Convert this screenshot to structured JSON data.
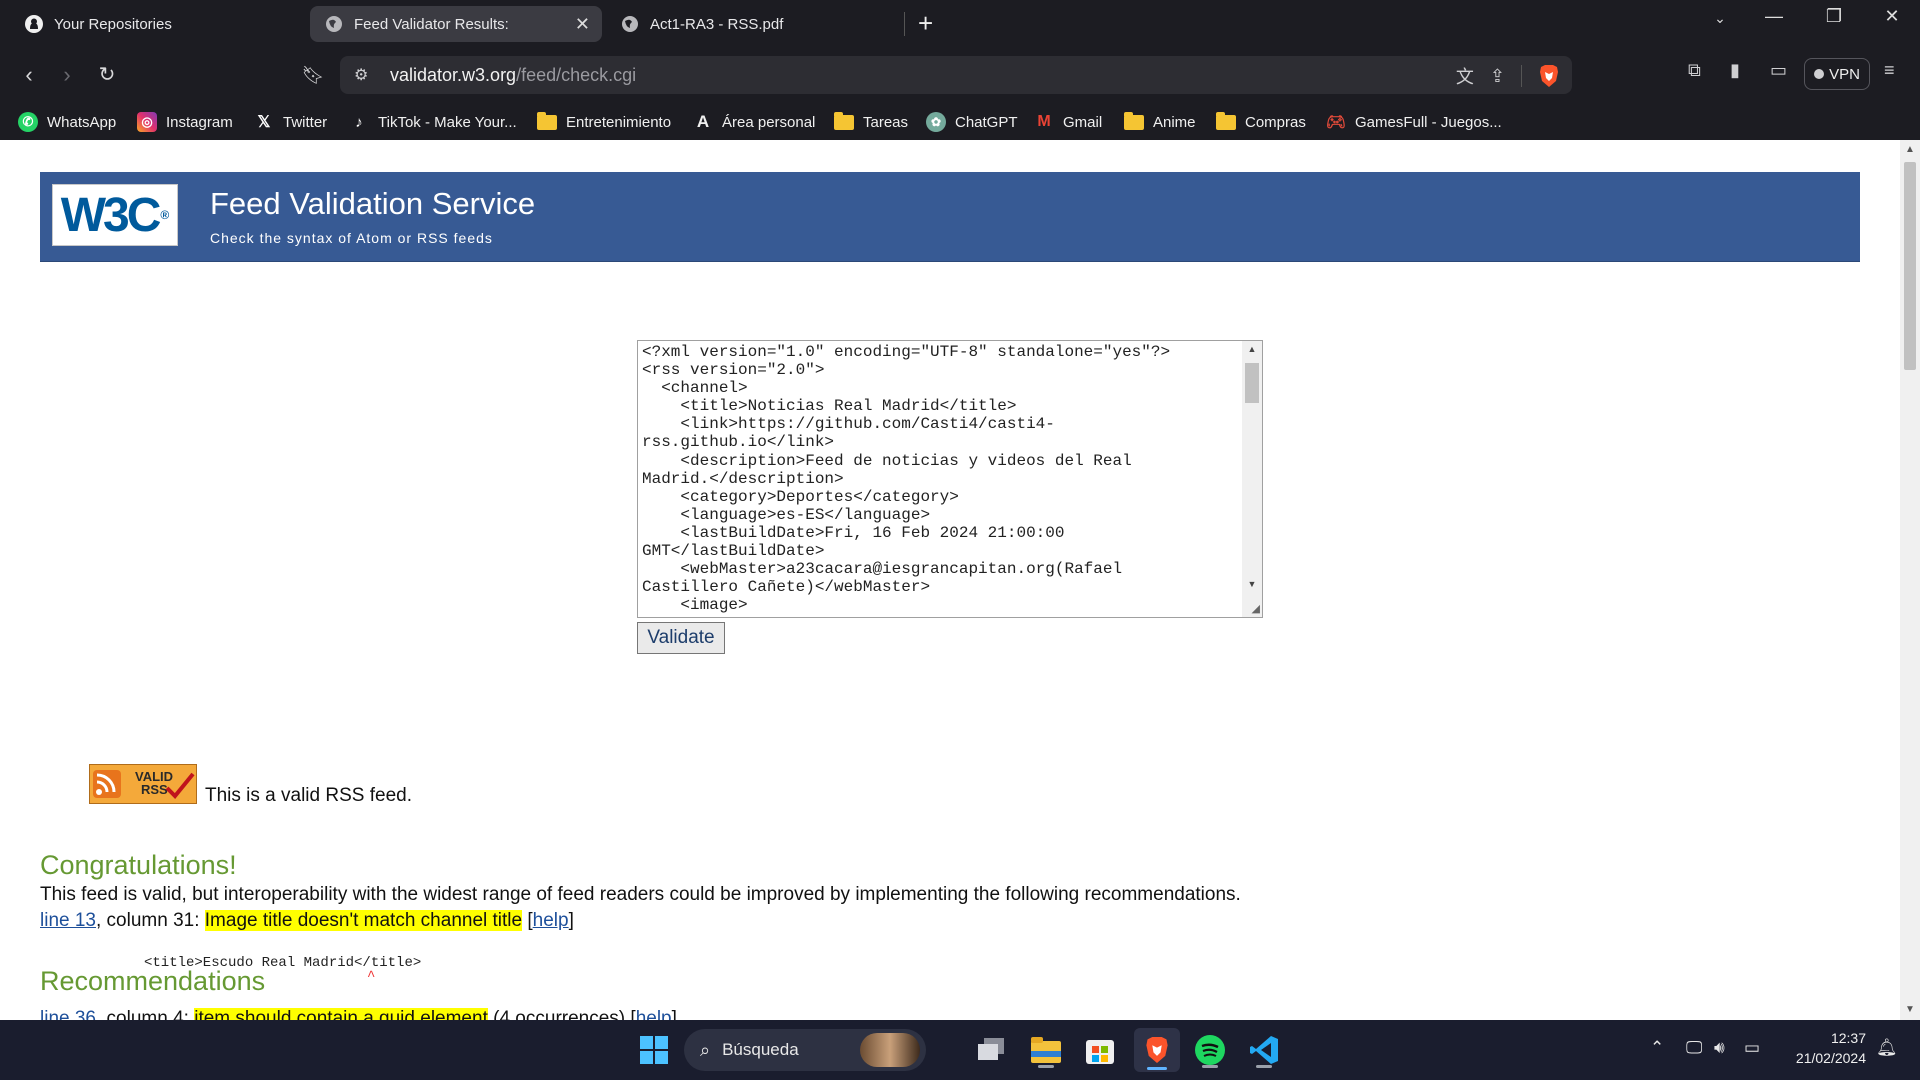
{
  "tabs": [
    {
      "label": "Your Repositories",
      "icon": "github-icon"
    },
    {
      "label": "Feed Validator Results:",
      "icon": "globe-icon",
      "active": true
    },
    {
      "label": "Act1-RA3 - RSS.pdf",
      "icon": "globe-icon"
    }
  ],
  "address": {
    "host": "validator.w3.org",
    "path": "/feed/check.cgi"
  },
  "vpn_label": "VPN",
  "bookmarks": [
    {
      "label": "WhatsApp",
      "icon": "whatsapp-icon"
    },
    {
      "label": "Instagram",
      "icon": "instagram-icon"
    },
    {
      "label": "Twitter",
      "icon": "x-icon"
    },
    {
      "label": "TikTok - Make Your...",
      "icon": "tiktok-icon"
    },
    {
      "label": "Entretenimiento",
      "icon": "folder-icon"
    },
    {
      "label": "Área personal",
      "icon": "moodle-icon"
    },
    {
      "label": "Tareas",
      "icon": "folder-icon"
    },
    {
      "label": "ChatGPT",
      "icon": "chatgpt-icon"
    },
    {
      "label": "Gmail",
      "icon": "gmail-icon"
    },
    {
      "label": "Anime",
      "icon": "folder-icon"
    },
    {
      "label": "Compras",
      "icon": "folder-icon"
    },
    {
      "label": "GamesFull - Juegos...",
      "icon": "gamepad-icon"
    }
  ],
  "page": {
    "banner_title": "Feed Validation Service",
    "banner_subtitle": "Check the syntax of Atom or RSS feeds",
    "logo_text": "W3C",
    "feed_source": "<?xml version=\"1.0\" encoding=\"UTF-8\" standalone=\"yes\"?>\n<rss version=\"2.0\">\n  <channel>\n    <title>Noticias Real Madrid</title>\n    <link>https://github.com/Casti4/casti4-\nrss.github.io</link>\n    <description>Feed de noticias y videos del Real\nMadrid.</description>\n    <category>Deportes</category>\n    <language>es-ES</language>\n    <lastBuildDate>Fri, 16 Feb 2024 21:00:00\nGMT</lastBuildDate>\n    <webMaster>a23cacara@iesgrancapitan.org(Rafael\nCastillero Cañete)</webMaster>\n    <image>\n      <url>https://www.realmadrid.com/",
    "validate_label": "Validate",
    "congrats_heading": "Congratulations!",
    "badge_text": "VALID RSS",
    "valid_message": "This is a valid RSS feed.",
    "recommendations_heading": "Recommendations",
    "recommendations_intro": "This feed is valid, but interoperability with the widest range of feed readers could be improved by implementing the following recommendations.",
    "rec1": {
      "line_link": "line 13",
      "column": ", column 31: ",
      "message": "Image title doesn't match channel title",
      "help": "help"
    },
    "rec1_code": "<title>Escudo Real Madrid</title>",
    "rec1_caret": "^",
    "rec2": {
      "line_link": "line 36",
      "column": ", column 4: ",
      "message": "item should contain a guid element",
      "extra": " (4 occurrences) [",
      "help": "help"
    }
  },
  "taskbar": {
    "search_placeholder": "Búsqueda",
    "time": "12:37",
    "date": "21/02/2024"
  }
}
